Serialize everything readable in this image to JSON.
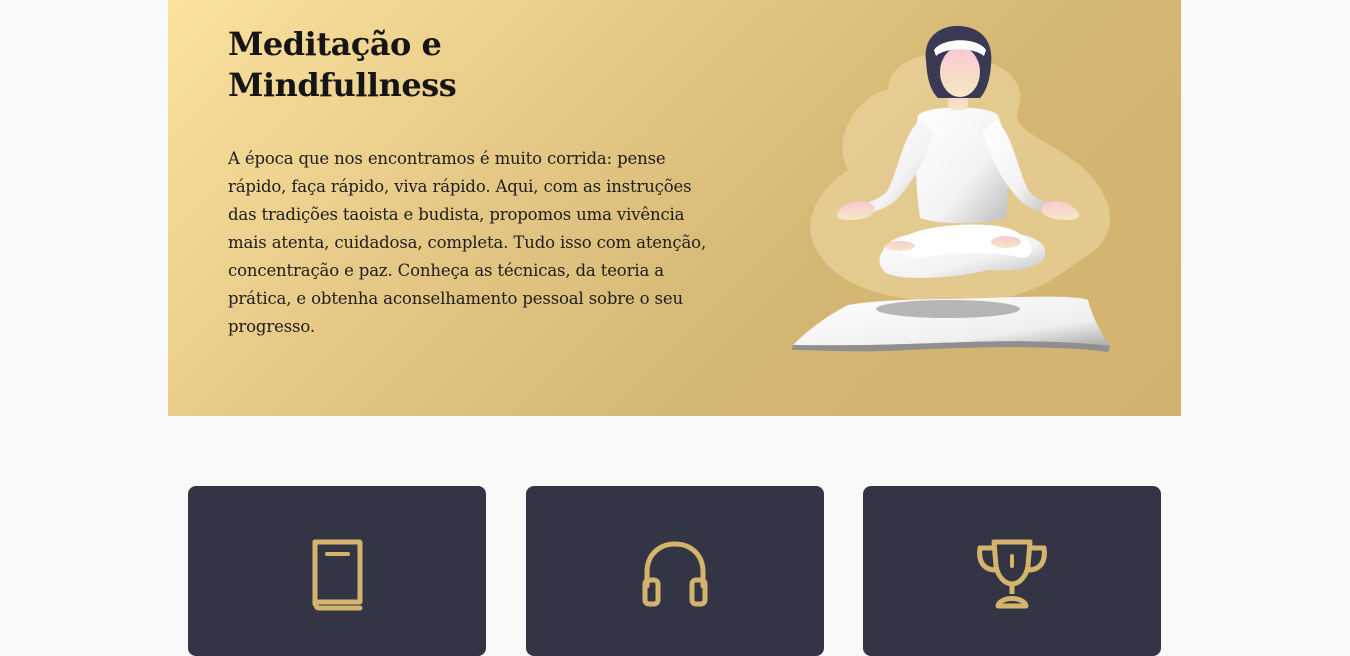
{
  "hero": {
    "title": "Meditação e Mindfullness",
    "description": "A época que nos encontramos é muito corrida: pense rápido, faça rápido, viva rápido. Aqui, com as instruções das tradições taoista e budista, propomos uma vivência mais atenta, cuidadosa, completa. Tudo isso com atenção, concentração e paz. Conheça as técnicas, da teoria a prática, e obtenha aconselhamento pessoal sobre o seu progresso.",
    "illustration": "meditating-woman-illustration"
  },
  "cards": [
    {
      "icon": "book-icon"
    },
    {
      "icon": "headphones-icon"
    },
    {
      "icon": "trophy-icon"
    }
  ],
  "colors": {
    "page_bg": "#f9f9f9",
    "hero_gradient_start": "#fbe29e",
    "hero_gradient_end": "#d2b26e",
    "card_bg": "#333444",
    "icon_gold": "#d4b36c",
    "text_dark": "#151515"
  }
}
